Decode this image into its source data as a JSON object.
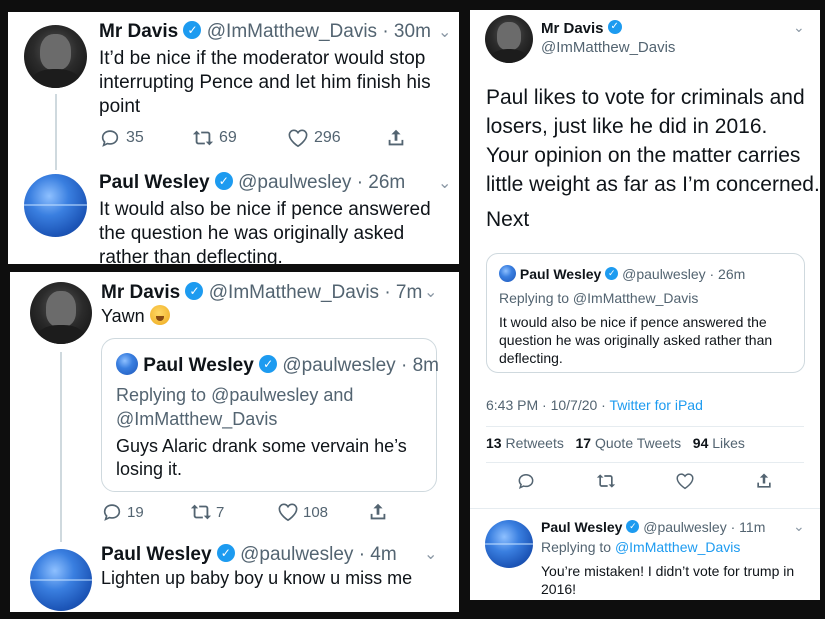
{
  "colors": {
    "accent": "#1d9bf0",
    "muted": "#536471",
    "border": "#cfd9de",
    "background": "#0e0e0e"
  },
  "icons": [
    "reply-icon",
    "retweet-icon",
    "like-icon",
    "share-icon",
    "verified-badge-icon",
    "chevron-down-icon"
  ],
  "panel1": {
    "tweet1": {
      "name": "Mr Davis",
      "handle": "@ImMatthew_Davis",
      "time": "· 30m",
      "text_l1": "It’d be nice if the moderator would stop",
      "text_l2": "interrupting Pence and let him finish his",
      "text_l3": "point",
      "replies": "35",
      "retweets": "69",
      "likes": "296"
    },
    "tweet2": {
      "name": "Paul Wesley",
      "handle": "@paulwesley",
      "time": "· 26m",
      "text_l1": "It would also be nice if pence answered",
      "text_l2": "the question he was originally asked",
      "text_l3": "rather than deflecting."
    }
  },
  "panel2": {
    "tweet1": {
      "name": "Mr Davis",
      "handle": "@ImMatthew_Davis",
      "time": "· 7m",
      "text": "Yawn",
      "quote": {
        "name": "Paul Wesley",
        "handle": "@paulwesley",
        "time": "· 8m",
        "reply_prefix": "Replying to",
        "reply_l1": "@paulwesley and",
        "reply_l2": "@ImMatthew_Davis",
        "text_l1": "Guys Alaric drank some vervain he’s",
        "text_l2": "losing it."
      },
      "replies": "19",
      "retweets": "7",
      "likes": "108"
    },
    "tweet2": {
      "name": "Paul Wesley",
      "handle": "@paulwesley",
      "time": "· 4m",
      "text": "Lighten up baby boy u know u miss me"
    }
  },
  "panel3": {
    "tweet": {
      "name": "Mr Davis",
      "handle": "@ImMatthew_Davis",
      "text_l1": "Paul likes to vote for criminals and",
      "text_l2": "losers, just like he did in 2016.",
      "text_l3": "Your opinion on the matter carries",
      "text_l4": "little weight as far as I’m concerned.",
      "text_l5": "Next",
      "quote": {
        "name": "Paul Wesley",
        "handle": "@paulwesley",
        "time": "· 26m",
        "replying": "Replying to @ImMatthew_Davis",
        "text_l1": "It would also be nice if pence answered the",
        "text_l2": "question he was originally asked rather than",
        "text_l3": "deflecting."
      },
      "timestamp": "6:43 PM · 10/7/20 ·",
      "source": "Twitter for iPad",
      "stats": {
        "retweets_count": "13",
        "retweets_label": "Retweets",
        "quotes_count": "17",
        "quotes_label": "Quote Tweets",
        "likes_count": "94",
        "likes_label": "Likes"
      }
    },
    "reply": {
      "name": "Paul Wesley",
      "handle": "@paulwesley",
      "time": "· 11m",
      "replying_prefix": "Replying to",
      "replying_handle": "@ImMatthew_Davis",
      "text_l1": "You’re mistaken! I didn’t vote for trump in",
      "text_l2": "2016!"
    }
  }
}
